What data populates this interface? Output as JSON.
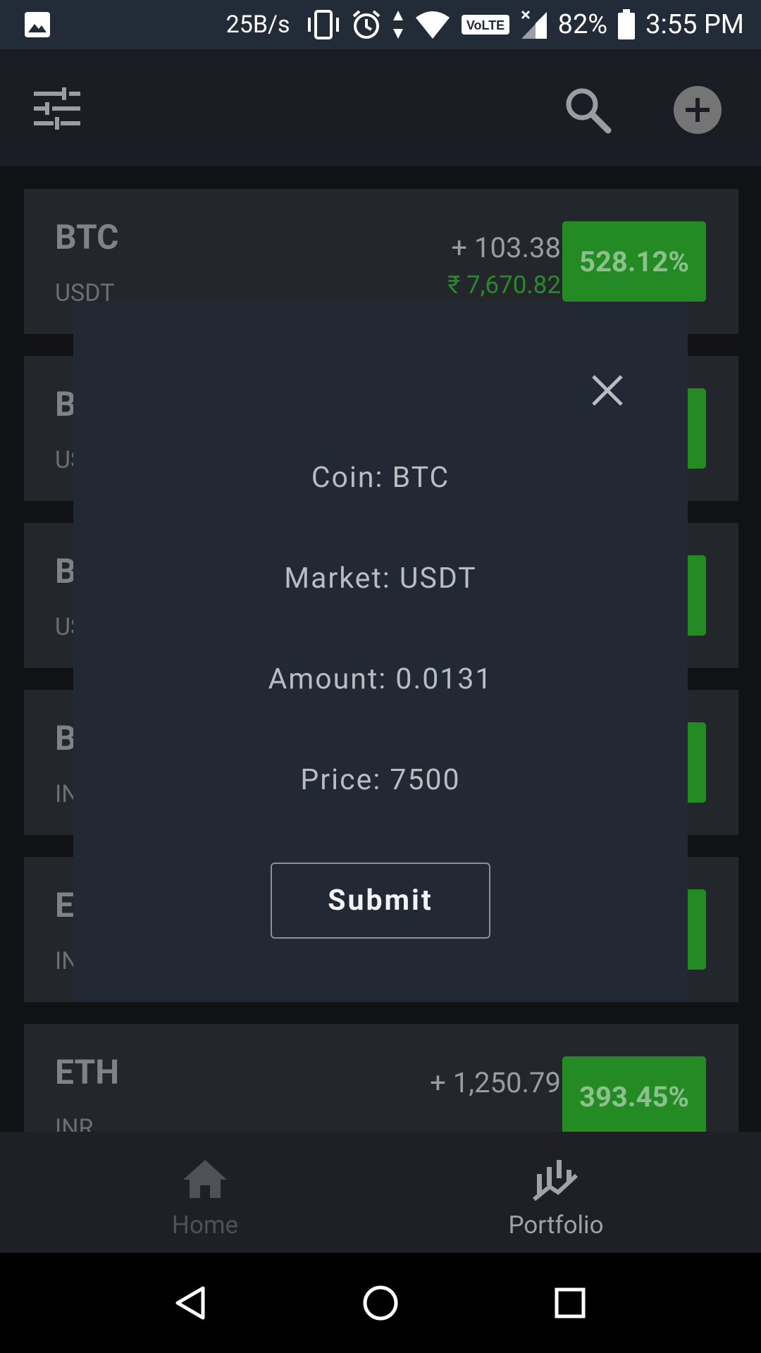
{
  "status_bar": {
    "net_speed": "25B/s",
    "battery": "82%",
    "time": "3:55 PM",
    "volte": "VoLTE"
  },
  "header": {
    "filter_icon": "tune-icon",
    "search_icon": "search-icon",
    "add_icon": "add-circle-icon"
  },
  "list": [
    {
      "coin": "BTC",
      "market": "USDT",
      "change": "+ 103.38",
      "value": "₹ 7,670.82",
      "pct": "528.12%"
    },
    {
      "coin": "B",
      "market": "US",
      "change": "",
      "value": "",
      "pct": ""
    },
    {
      "coin": "B",
      "market": "US",
      "change": "",
      "value": "",
      "pct": ""
    },
    {
      "coin": "B",
      "market": "IN",
      "change": "",
      "value": "",
      "pct": ""
    },
    {
      "coin": "E",
      "market": "IN",
      "change": "",
      "value": "",
      "pct": ""
    },
    {
      "coin": "ETH",
      "market": "INR",
      "change": "+ 1,250.79",
      "value": "",
      "pct": "393.45%"
    }
  ],
  "dialog": {
    "coin": "Coin: BTC",
    "market": "Market: USDT",
    "amount": "Amount: 0.0131",
    "price": "Price: 7500",
    "submit": "Submit"
  },
  "bottom_nav": {
    "home": "Home",
    "portfolio": "Portfolio"
  },
  "colors": {
    "positive": "#248a24",
    "dialog_bg": "#222834",
    "card_bg": "#23262b"
  }
}
